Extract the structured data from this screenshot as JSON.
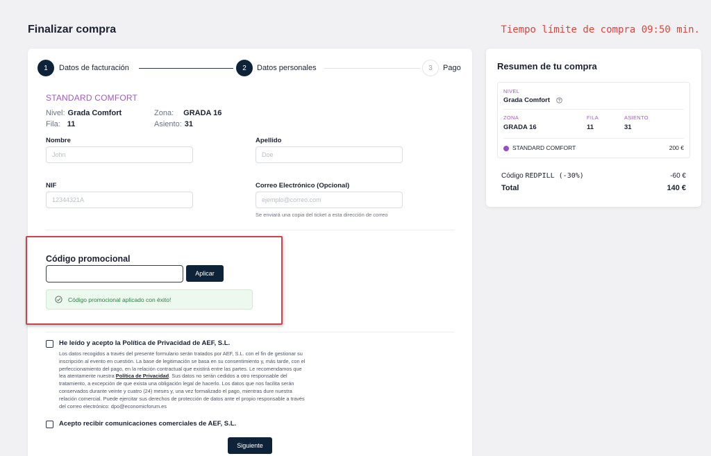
{
  "header": {
    "title": "Finalizar compra",
    "timer_label": "Tiempo límite de compra",
    "timer_value": "09:50 min."
  },
  "steps": [
    {
      "number": "1",
      "label": "Datos de facturación",
      "state": "active"
    },
    {
      "number": "2",
      "label": "Datos personales",
      "state": "active"
    },
    {
      "number": "3",
      "label": "Pago",
      "state": "inactive"
    }
  ],
  "ticket": {
    "title": "STANDARD COMFORT",
    "nivel_label": "Nivel:",
    "nivel_value": "Grada Comfort",
    "zona_label": "Zona:",
    "zona_value": "GRADA 16",
    "fila_label": "Fila:",
    "fila_value": "11",
    "asiento_label": "Asiento:",
    "asiento_value": "31"
  },
  "form": {
    "nombre_label": "Nombre",
    "nombre_placeholder": "John",
    "apellido_label": "Apellido",
    "apellido_placeholder": "Doe",
    "nif_label": "NIF",
    "nif_placeholder": "12344321A",
    "email_label": "Correo Electrónico (Opcional)",
    "email_placeholder": "ejemplo@correo.com",
    "email_hint": "Se enviará una copia del ticket a esta dirección de correo"
  },
  "promo": {
    "title": "Código promocional",
    "input_value": "",
    "apply_label": "Aplicar",
    "success_message": "Código promocional aplicado con éxito!"
  },
  "consent": {
    "privacy_label": "He leído y acepto la Política de Privacidad de AEF, S.L.",
    "legal_text_before": "Los datos recogidos a través del presente formulario serán tratados por AEF, S.L. con el fin de gestionar su inscripción al evento en cuestión. La base de legitimación se basa en su consentimiento y, más tarde, con el perfeccionamiento del pago, en la relación contractual que existirá entre las partes. Le recomendamos que lea atentamente nuestra ",
    "legal_link": "Política de Privacidad",
    "legal_text_after": ". Sus datos no serán cedidos a otro responsable del tratamiento, a excepción de que exista una obligación legal de hacerlo. Los datos que nos facilita serán conservados durante veinte y cuatro (24) meses y, una vez formalizado el pago, mientras dure nuestra relación comercial. Puede ejercitar sus derechos de protección de datos ante el propio responsable a través del correo electrónico: dpo@economicforum.es",
    "marketing_label": "Acepto recibir comunicaciones comerciales de AEF, S.L."
  },
  "next_label": "Siguiente",
  "summary": {
    "title": "Resumen de tu compra",
    "nivel_label": "NIVEL",
    "nivel_value": "Grada Comfort",
    "zona_label": "ZONA",
    "zona_value": "GRADA 16",
    "fila_label": "FILA",
    "fila_value": "11",
    "asiento_label": "ASIENTO",
    "asiento_value": "31",
    "product_name": "STANDARD COMFORT",
    "product_price": "200 €",
    "code_label": "Código",
    "code_value": "REDPILL (-30%)",
    "code_amount": "-60 €",
    "total_label": "Total",
    "total_amount": "140 €"
  },
  "colors": {
    "accent_dark": "#0f2338",
    "timer": "#e0433b",
    "purple": "#a05bbb",
    "success": "#2f7d43",
    "highlight": "#c8434b"
  }
}
